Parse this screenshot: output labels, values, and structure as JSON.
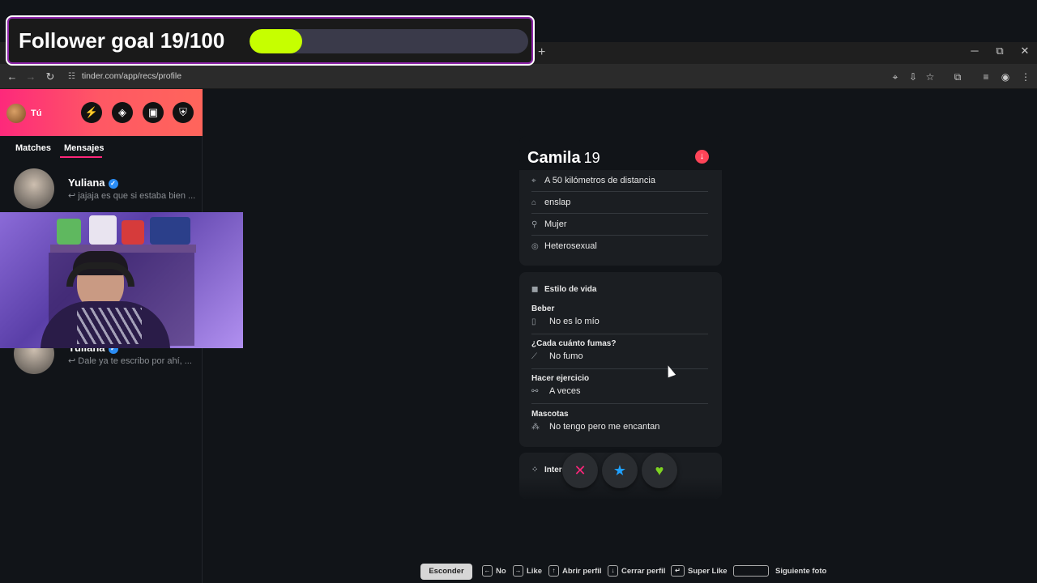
{
  "overlay": {
    "goal_text": "Follower goal 19/100",
    "progress_fraction": 0.19,
    "fill_color": "#c6ff00"
  },
  "browser": {
    "url": "tinder.com/app/recs/profile",
    "new_tab": "+",
    "win_minimize": "─",
    "win_restore": "⧉",
    "win_close": "✕",
    "back": "←",
    "forward": "→",
    "reload": "↻",
    "icons": [
      "location-icon",
      "install-icon",
      "star-icon",
      "extensions-icon",
      "media-icon",
      "profile-icon",
      "menu-icon"
    ]
  },
  "sidebar": {
    "me_label": "Tú",
    "tabs": [
      "Matches",
      "Mensajes"
    ],
    "active_tab": "Mensajes",
    "conversations": [
      {
        "name": "Yuliana",
        "preview": "jajaja es que si estaba bien ...",
        "verified": true
      },
      {
        "name": "Yuliana",
        "preview": "Dale ya te escribo por ahí, ...",
        "verified": true
      }
    ],
    "reply_arrow": "↩"
  },
  "profile": {
    "name": "Camila",
    "age": "19",
    "basics": [
      {
        "icon": "location-pin-icon",
        "glyph": "⌖",
        "text": "A 50 kilómetros de distancia"
      },
      {
        "icon": "graduation-cap-icon",
        "glyph": "⌂",
        "text": "enslap"
      },
      {
        "icon": "person-icon",
        "glyph": "⚲",
        "text": "Mujer"
      },
      {
        "icon": "orientation-icon",
        "glyph": "◎",
        "text": "Heterosexual"
      }
    ],
    "lifestyle": {
      "title": "Estilo de vida",
      "items": [
        {
          "label": "Beber",
          "value": "No es lo mío",
          "icon": "glass-icon",
          "glyph": "▯"
        },
        {
          "label": "¿Cada cuánto fumas?",
          "value": "No fumo",
          "icon": "smoking-icon",
          "glyph": "⟋"
        },
        {
          "label": "Hacer ejercicio",
          "value": "A veces",
          "icon": "dumbbell-icon",
          "glyph": "⚯"
        },
        {
          "label": "Mascotas",
          "value": "No tengo pero me encantan",
          "icon": "paw-icon",
          "glyph": "⁂"
        }
      ]
    },
    "interests_title": "Intere"
  },
  "actions": {
    "nope": "✕",
    "superlike": "★",
    "like": "♥",
    "nope_color": "#fd267a",
    "superlike_color": "#1fa1ff",
    "like_color": "#7ed321"
  },
  "hints": {
    "hide": "Esconder",
    "no": "No",
    "like": "Like",
    "open_profile": "Abrir perfil",
    "close_profile": "Cerrar perfil",
    "super_like": "Super Like",
    "next_photo": "Siguiente foto",
    "keys": {
      "left": "←",
      "right": "→",
      "up": "↑",
      "down": "↓",
      "enter": "↵"
    }
  }
}
